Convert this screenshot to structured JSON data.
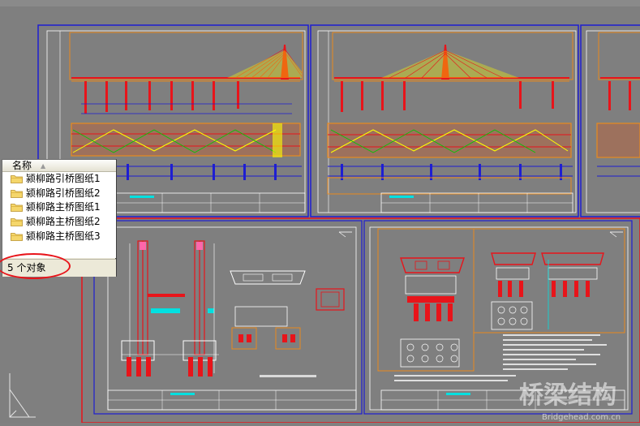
{
  "panel": {
    "column_header": "名称",
    "items": [
      {
        "label": "颍柳路引桥图纸1"
      },
      {
        "label": "颍柳路引桥图纸2"
      },
      {
        "label": "颍柳路主桥图纸1"
      },
      {
        "label": "颍柳路主桥图纸2"
      },
      {
        "label": "颍柳路主桥图纸3"
      }
    ],
    "status": "5 个对象"
  },
  "watermark": {
    "text": "桥梁结构",
    "url": "Bridgehead.com.cn"
  },
  "colors": {
    "background": "#808080",
    "drawing_border_blue": "#1e1ed2",
    "drawing_border_red": "#e8141a",
    "cad_orange": "#e88a1e",
    "cad_red": "#e8141a",
    "cad_yellow": "#ffff00",
    "cad_cyan": "#00e0e0",
    "cad_green": "#00c800"
  }
}
